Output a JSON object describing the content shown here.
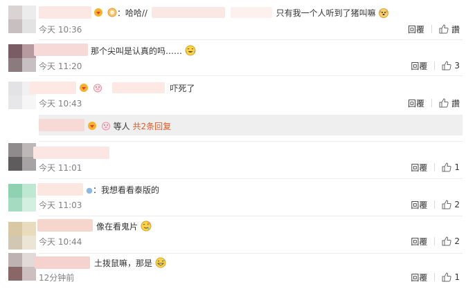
{
  "comments": [
    {
      "id": "c1",
      "avatar_colors": [
        "#d9d3d3",
        "#ececec",
        "#c8c0c0",
        "#e3e3e3"
      ],
      "name_blur_color": "#fbe7e3",
      "text_parts": [
        "：哈哈//",
        "只有我一个人听到了猪叫嘛"
      ],
      "time": "今天 10:36",
      "reply_label": "回覆",
      "like_label": "讚",
      "emojis": [
        "dog-face-emoji"
      ]
    },
    {
      "id": "c2",
      "avatar_colors": [
        "#7a5c64",
        "#b59aa0",
        "#8b7b7e",
        "#c7bfc1"
      ],
      "name_blur_color": "#f7d9d7",
      "text": "那个尖叫是认真的吗……",
      "time": "今天 11:20",
      "reply_label": "回覆",
      "like_count": "3",
      "emojis": [
        "laughing-tears-emoji"
      ]
    },
    {
      "id": "c3",
      "avatar_colors": [
        "#e3e3e6",
        "#f1f1f3",
        "#e7e7ea",
        "#f6f6f7"
      ],
      "name_blur_color": "#fde8e4",
      "text": "吓死了",
      "time": "今天 10:43",
      "reply_label": "回覆",
      "like_label": "讚",
      "sub": {
        "text": "等人",
        "more": "共2条回复"
      }
    },
    {
      "id": "c4",
      "avatar_colors": [
        "#8f8a8b",
        "#bdb7b8",
        "#5f5c5d",
        "#a7a2a3"
      ],
      "name_blur_color": "#fbe6e4",
      "time": "今天 11:01",
      "reply_label": "回覆",
      "like_count": "1"
    },
    {
      "id": "c5",
      "avatar_colors": [
        "#8fd2b1",
        "#bfe8d3",
        "#a3dcc0",
        "#d2efe0"
      ],
      "name_blur_color": "#fbe7e0",
      "text": "：我想看看泰版的",
      "time": "今天 11:03",
      "reply_label": "回覆",
      "like_count": "2"
    },
    {
      "id": "c6",
      "avatar_colors": [
        "#d8c9a4",
        "#e9dcbd",
        "#d2c7b2",
        "#ece5d6"
      ],
      "name_blur_color": "#f6d5cd",
      "text": "像在看鬼片",
      "time": "今天 10:44",
      "reply_label": "回覆",
      "like_count": "2",
      "emojis": [
        "drooling-face-emoji"
      ]
    },
    {
      "id": "c7",
      "avatar_colors": [
        "#bfb2b2",
        "#e2d9d9",
        "#8a6767",
        "#cdbfbf"
      ],
      "name_blur_color": "#f6d2ce",
      "text": "土拨鼠嘛，那是",
      "time": "12分钟前",
      "reply_label": "回覆",
      "like_count": "1",
      "emojis": [
        "grinning-sweat-emoji"
      ]
    }
  ],
  "colors": {
    "accent": "#e15a25",
    "time_text": "#808080",
    "sub_panel_bg": "#efefef"
  }
}
